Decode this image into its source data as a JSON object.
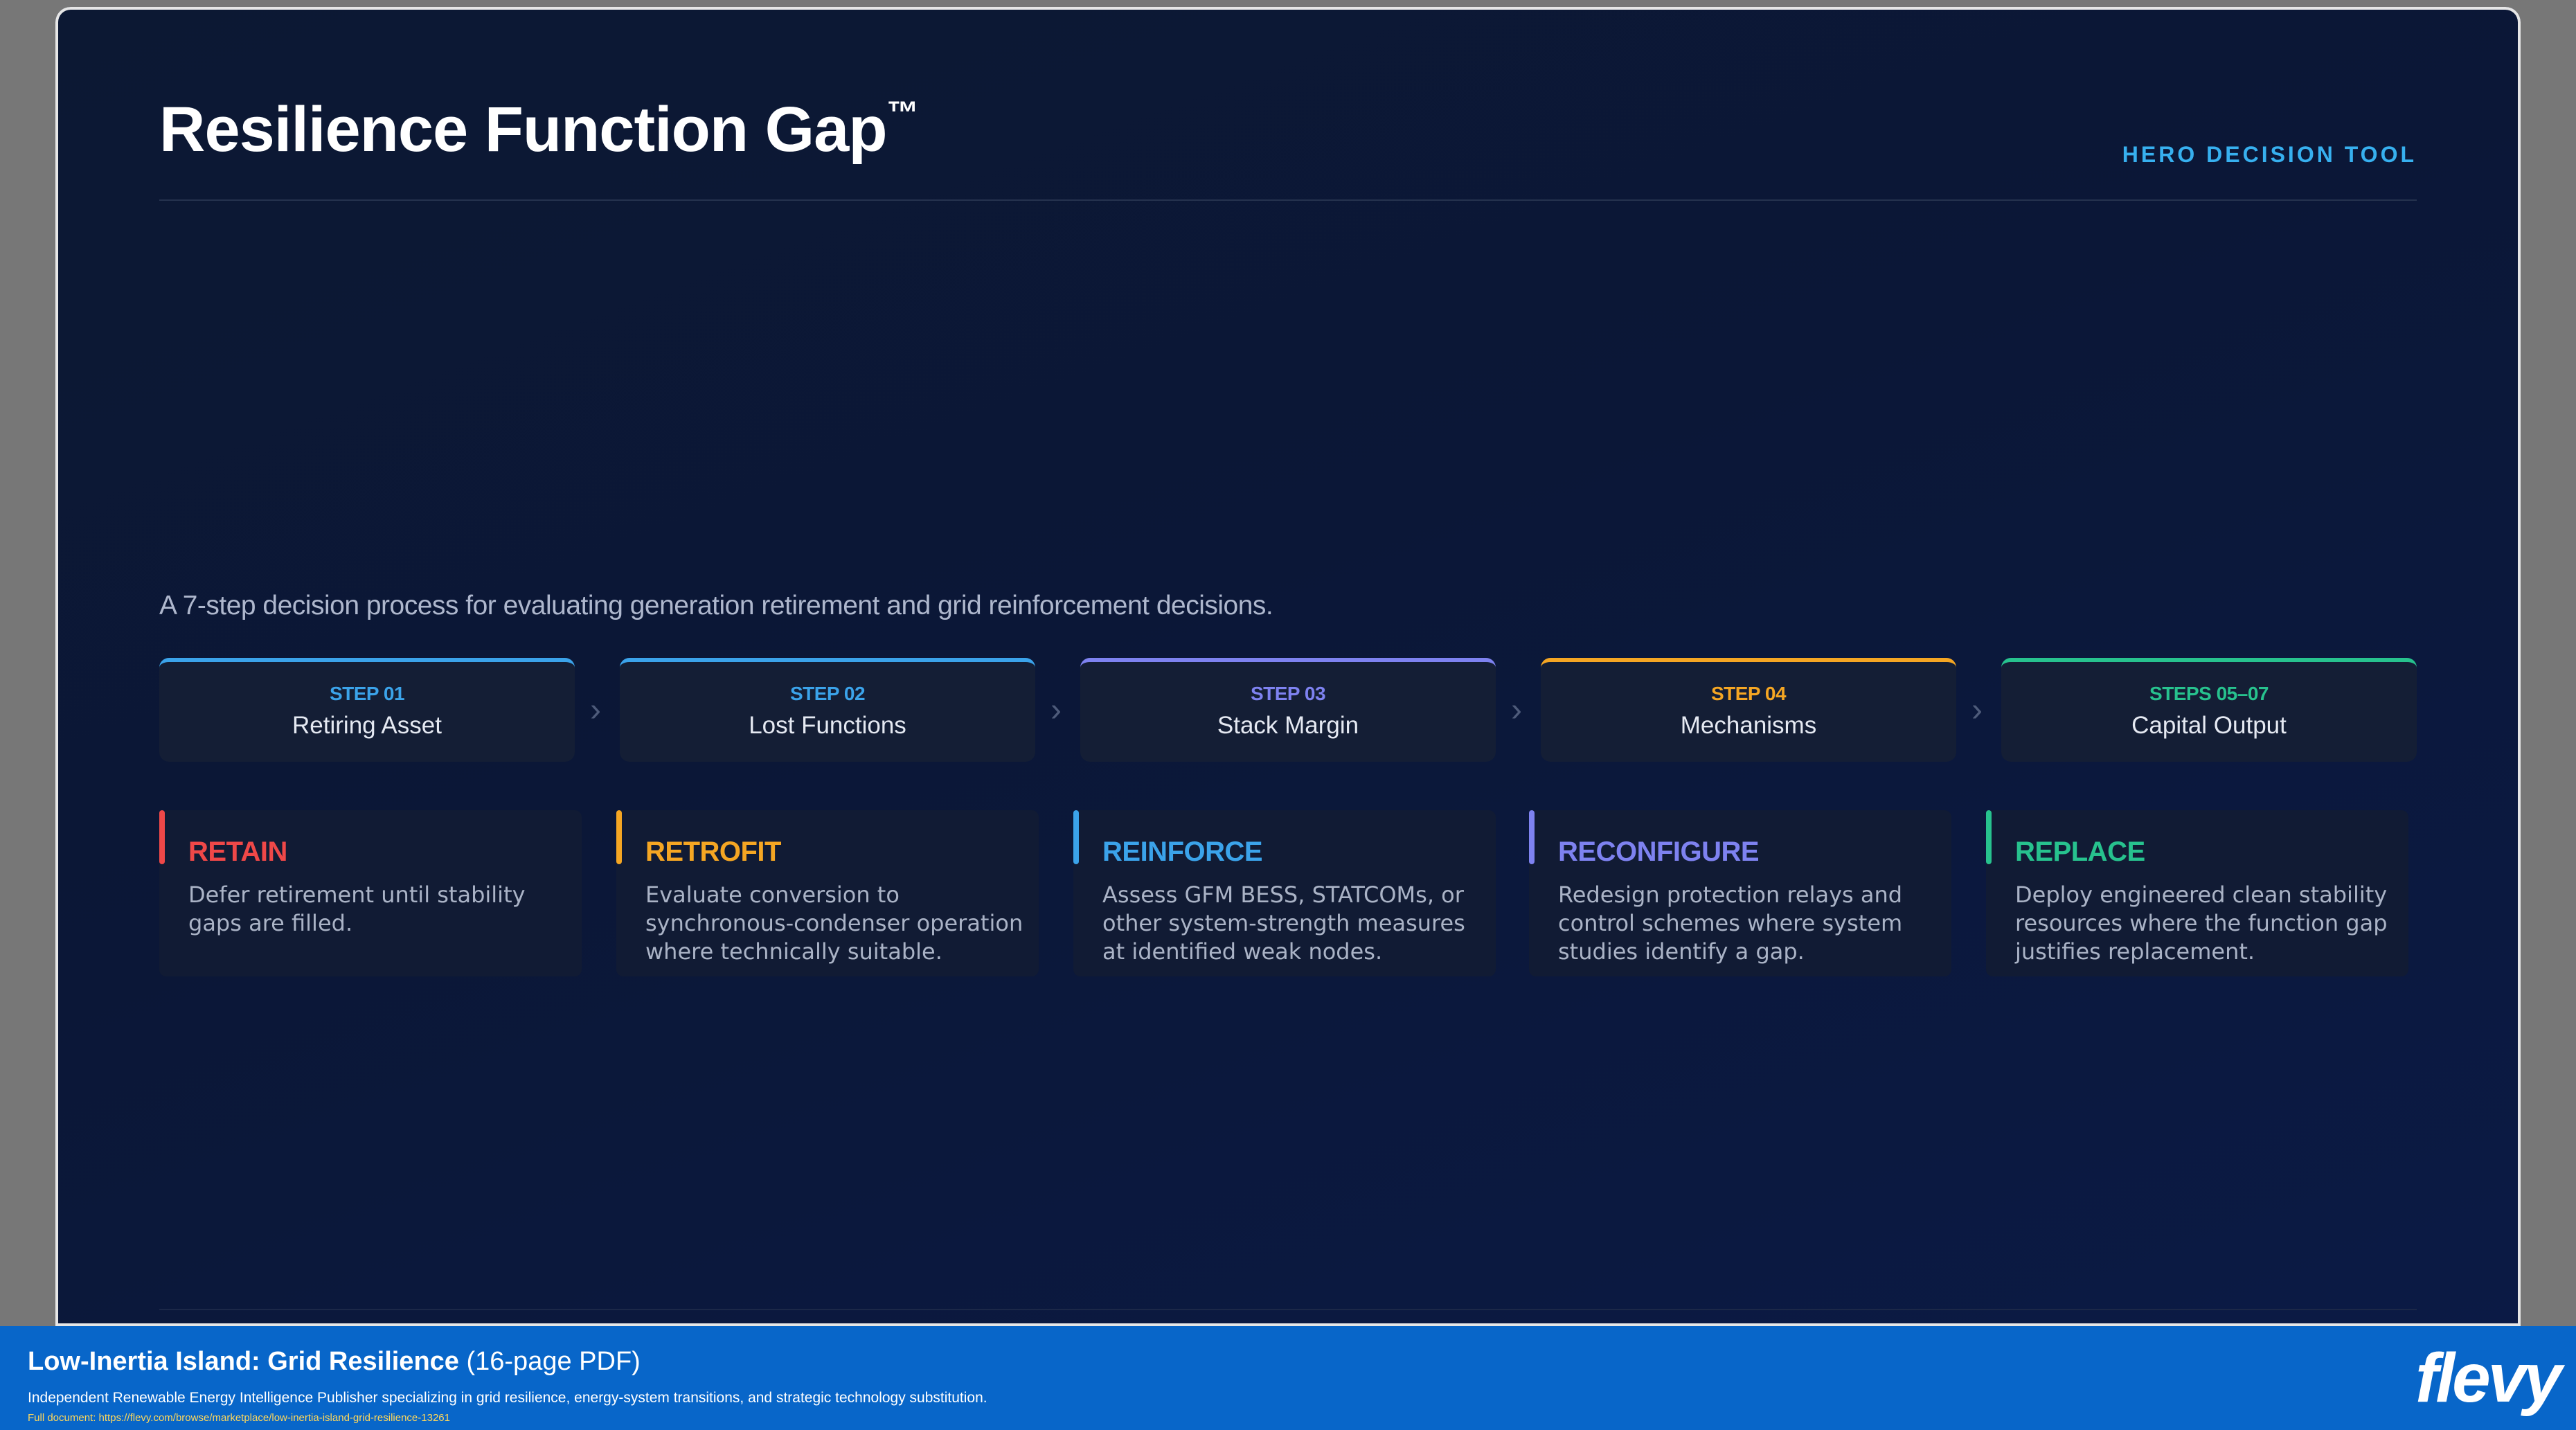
{
  "slide": {
    "title": "Resilience Function Gap",
    "title_mark": "™",
    "tag": "HERO DECISION TOOL",
    "subtitle": "A 7-step decision process for evaluating generation retirement and grid reinforcement decisions."
  },
  "steps": [
    {
      "num": "STEP 01",
      "name": "Retiring Asset",
      "color": "#3ba3ea"
    },
    {
      "num": "STEP 02",
      "name": "Lost Functions",
      "color": "#3ba3ea"
    },
    {
      "num": "STEP 03",
      "name": "Stack Margin",
      "color": "#7e82f0"
    },
    {
      "num": "STEP 04",
      "name": "Mechanisms",
      "color": "#f5a623"
    },
    {
      "num": "STEPS 05–07",
      "name": "Capital Output",
      "color": "#27c28e"
    }
  ],
  "arrows": [
    "›",
    "›",
    "›",
    "›"
  ],
  "options": [
    {
      "label": "RETAIN",
      "desc": "Defer retirement until stability gaps are filled.",
      "color": "#ef4848"
    },
    {
      "label": "RETROFIT",
      "desc": "Evaluate conversion to synchronous-condenser operation where technically suitable.",
      "color": "#f5a623"
    },
    {
      "label": "REINFORCE",
      "desc": "Assess GFM BESS, STATCOMs, or other system-strength measures at identified weak nodes.",
      "color": "#3ba3ea"
    },
    {
      "label": "RECONFIGURE",
      "desc": "Redesign protection relays and control schemes where system studies identify a gap.",
      "color": "#7e82f0"
    },
    {
      "label": "REPLACE",
      "desc": "Deploy engineered clean stability resources where the function gap justifies replacement.",
      "color": "#27c28e"
    }
  ],
  "banner": {
    "title": "Low-Inertia Island: Grid Resilience",
    "title_suffix": "(16-page PDF)",
    "description": "Independent Renewable Energy Intelligence Publisher specializing in grid resilience, energy-system transitions, and strategic technology substitution.",
    "link": "Full document: https://flevy.com/browse/marketplace/low-inertia-island-grid-resilience-13261",
    "logo": "flevy"
  }
}
